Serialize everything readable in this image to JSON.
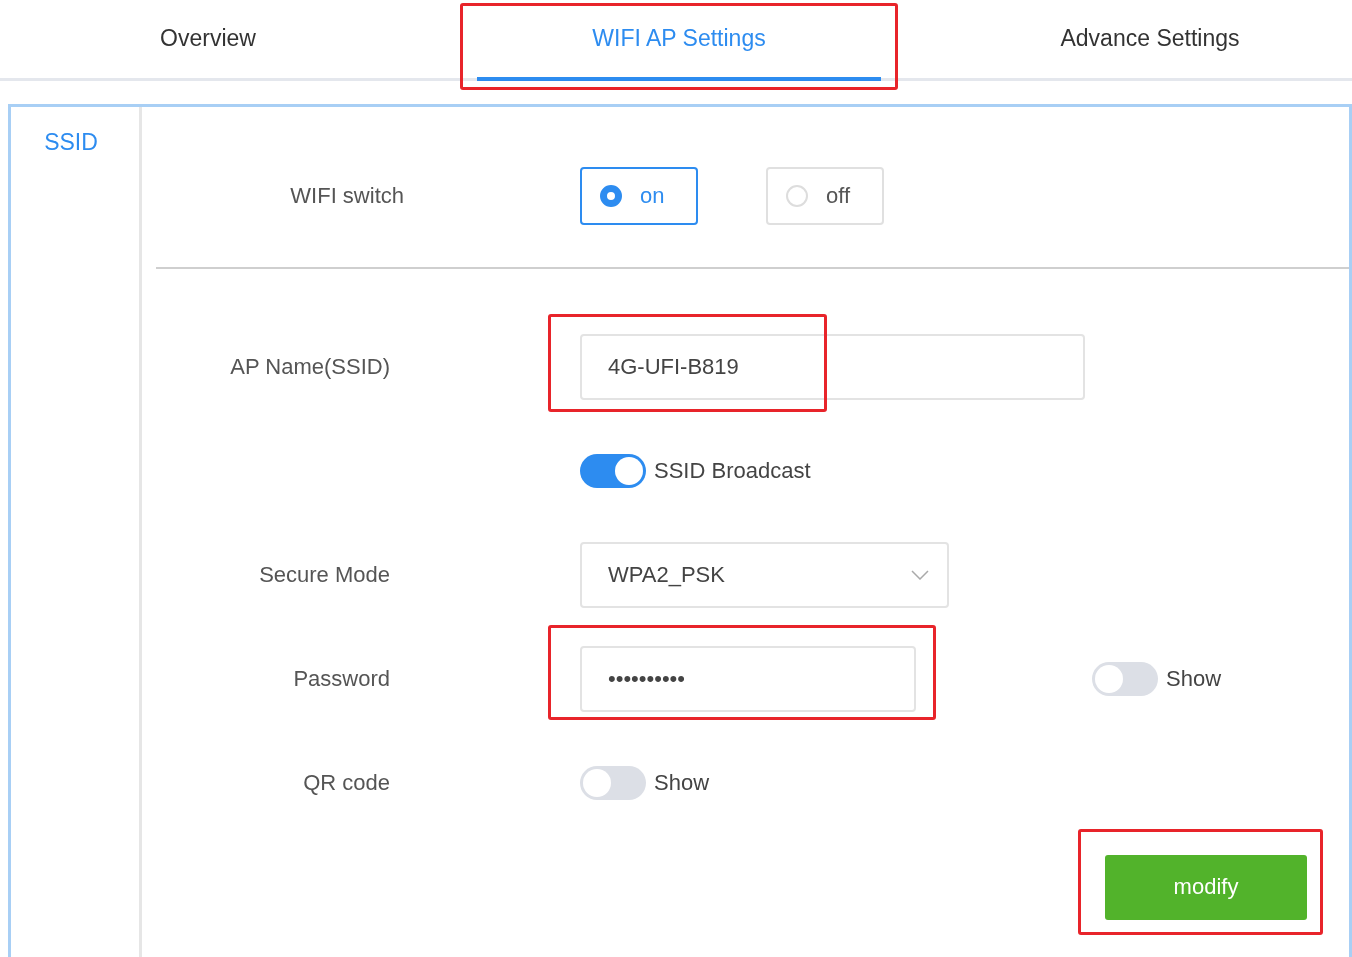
{
  "tabs": [
    {
      "label": "Overview",
      "selected": false,
      "highlighted": false
    },
    {
      "label": "WIFI AP Settings",
      "selected": true,
      "highlighted": true
    },
    {
      "label": "Advance Settings",
      "selected": false,
      "highlighted": false
    }
  ],
  "sidebar": {
    "items": [
      {
        "label": "SSID",
        "selected": true
      }
    ]
  },
  "wifi_switch": {
    "label": "WIFI switch",
    "options": [
      {
        "label": "on",
        "selected": true
      },
      {
        "label": "off",
        "selected": false
      }
    ]
  },
  "ap_name": {
    "label": "AP Name(SSID)",
    "value": "4G-UFI-B819",
    "highlighted": true
  },
  "ssid_broadcast": {
    "label": "SSID Broadcast",
    "on": true
  },
  "secure_mode": {
    "label": "Secure Mode",
    "value": "WPA2_PSK"
  },
  "password": {
    "label": "Password",
    "value": "••••••••••",
    "highlighted": true,
    "show_label": "Show",
    "show_on": false
  },
  "qr_code": {
    "label": "QR code",
    "show_label": "Show",
    "show_on": false
  },
  "modify_button": {
    "label": "modify",
    "highlighted": true
  }
}
